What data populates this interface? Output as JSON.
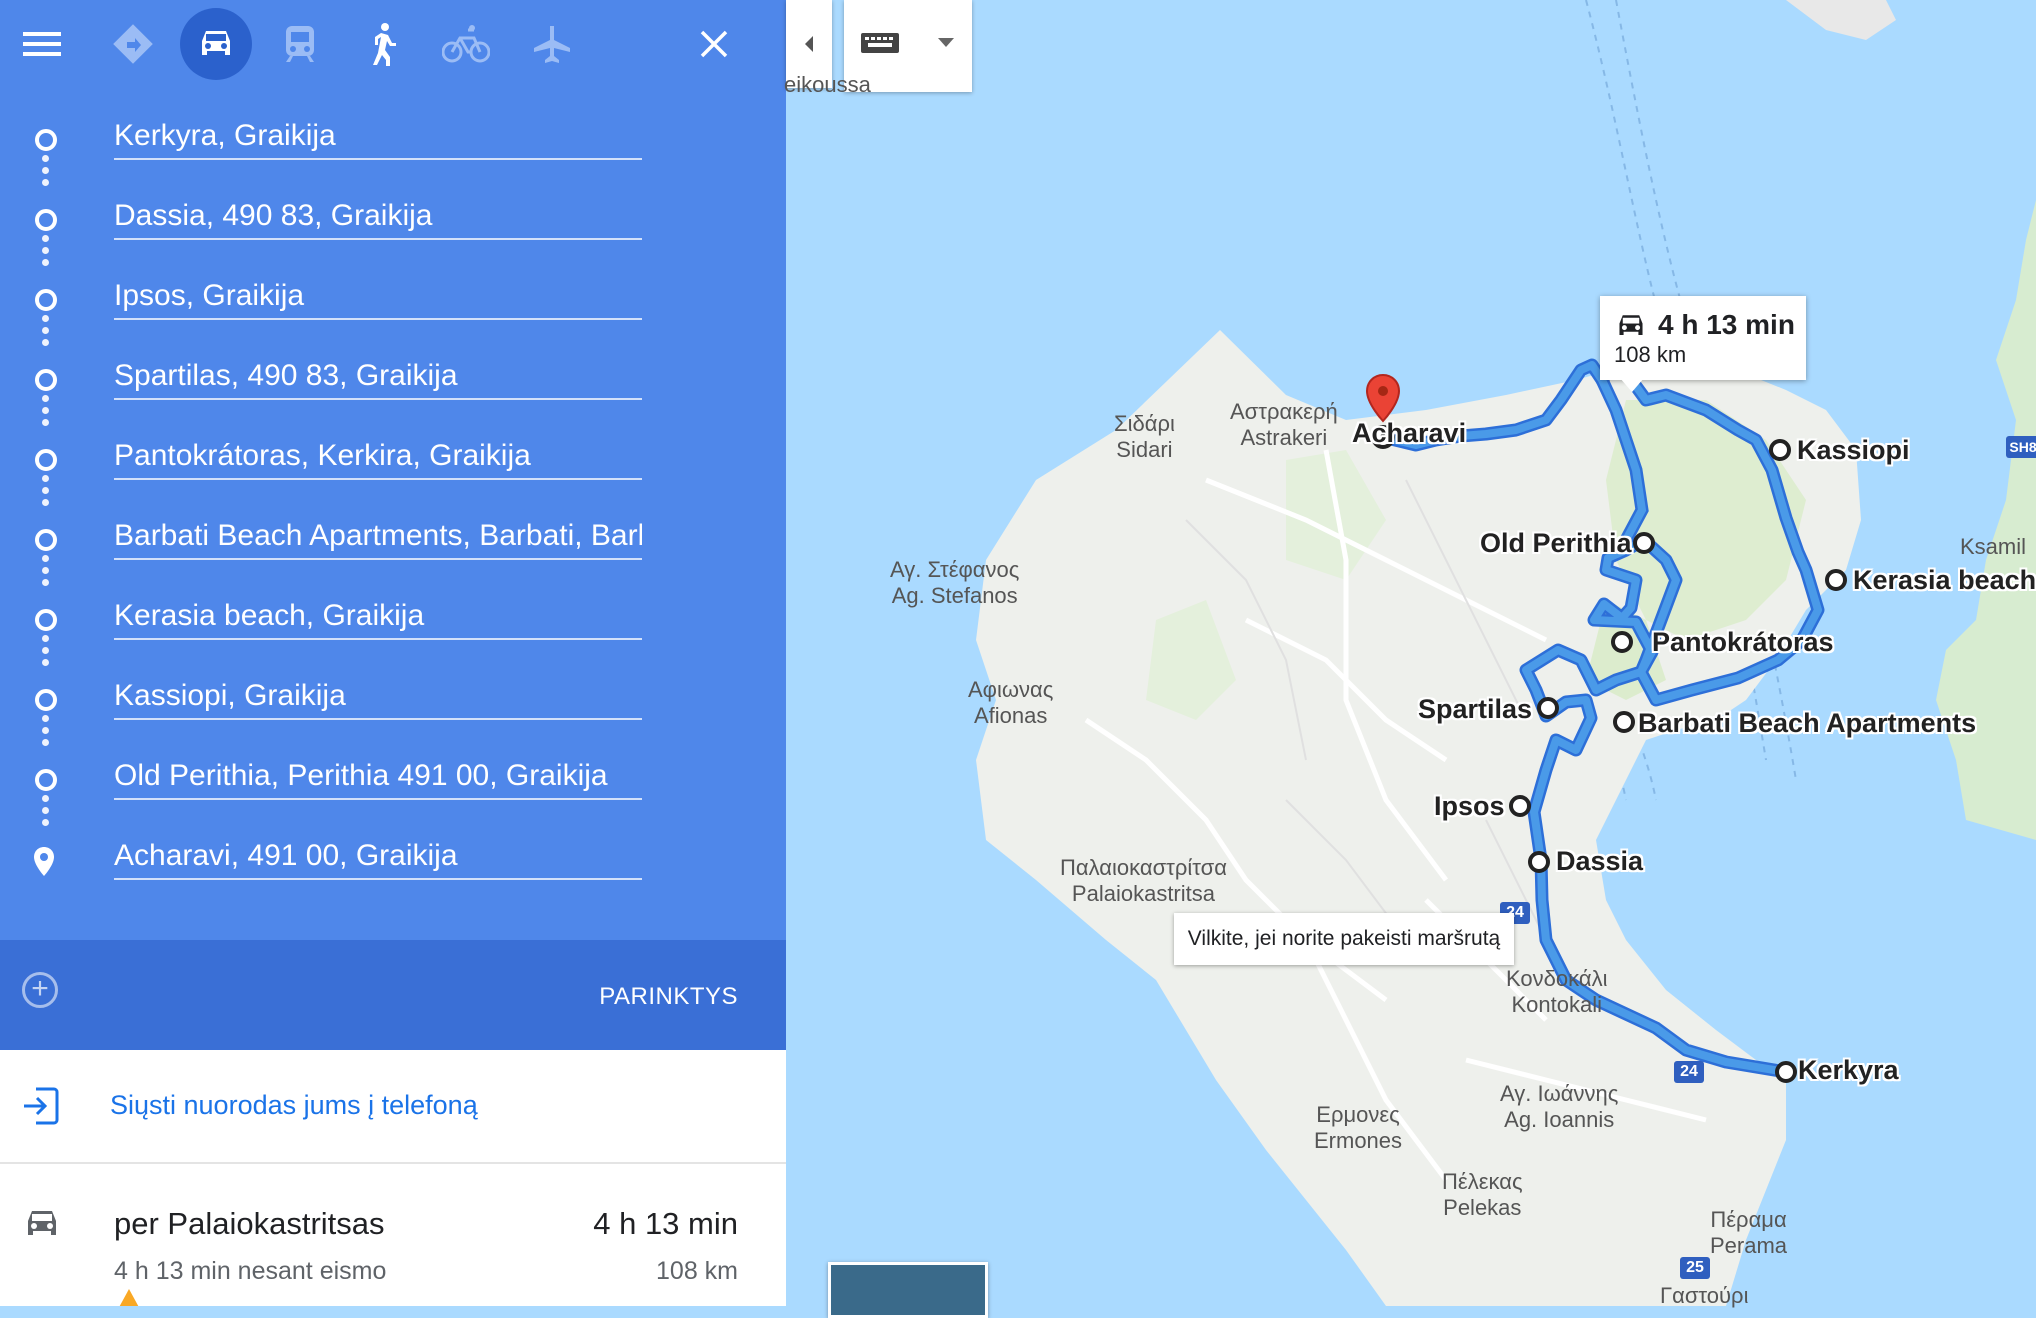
{
  "travel_modes": [
    {
      "name": "best-route",
      "active": false
    },
    {
      "name": "driving",
      "active": true
    },
    {
      "name": "transit",
      "active": false
    },
    {
      "name": "walking",
      "active": false
    },
    {
      "name": "cycling",
      "active": false
    },
    {
      "name": "flights",
      "active": false
    }
  ],
  "waypoints": [
    "Kerkyra, Graikija",
    "Dassia, 490 83, Graikija",
    "Ipsos, Graikija",
    "Spartilas, 490 83, Graikija",
    "Pantokrátoras, Kerkira, Graikija",
    "Barbati Beach Apartments, Barbati, Barbati, Graikija",
    "Kerasia beach, Graikija",
    "Kassiopi, Graikija",
    "Old Perithia, Perithia 491 00, Graikija",
    "Acharavi, 491 00, Graikija"
  ],
  "options_label": "PARINKTYS",
  "send_to_phone": "Siųsti nuorodas jums į telefoną",
  "route": {
    "via": "per Palaiokastritsas",
    "duration": "4 h 13 min",
    "traffic_note": "4 h 13 min nesant eismo",
    "distance": "108 km"
  },
  "map": {
    "route_color": "#4a9ae8",
    "info_box": {
      "duration": "4 h 13 min",
      "distance": "108 km"
    },
    "tooltip": "Vilkite, jei norite pakeisti maršrutą",
    "waypoint_labels": [
      "Acharavi",
      "Kassiopi",
      "Old Perithia",
      "Kerasia beach",
      "Pantokrátoras",
      "Spartilas",
      "Barbati Beach Apartments",
      "Ipsos",
      "Dassia",
      "Kerkyra"
    ],
    "place_labels": [
      {
        "id": "sidari",
        "greek": "Σιδάρι",
        "latin": "Sidari"
      },
      {
        "id": "astrakeri",
        "greek": "Αστρακερή",
        "latin": "Astrakeri"
      },
      {
        "id": "agstefanos",
        "greek": "Αγ. Στέφανος",
        "latin": "Ag. Stefanos"
      },
      {
        "id": "afionas",
        "greek": "Αφιωνας",
        "latin": "Afionas"
      },
      {
        "id": "palaiokastritsa",
        "greek": "Παλαιοκαστρίτσα",
        "latin": "Palaiokastritsa"
      },
      {
        "id": "kontokali",
        "greek": "Κονδοκάλι",
        "latin": "Kontokali"
      },
      {
        "id": "agioannis",
        "greek": "Αγ. Ιωάννης",
        "latin": "Ag. Ioannis"
      },
      {
        "id": "ermones",
        "greek": "Ερμονες",
        "latin": "Ermones"
      },
      {
        "id": "pelekas",
        "greek": "Πέλεκας",
        "latin": "Pelekas"
      },
      {
        "id": "perama",
        "greek": "Πέραμα",
        "latin": "Perama"
      },
      {
        "id": "gastouri",
        "greek": "Γαστούρι",
        "latin": ""
      },
      {
        "id": "ksamil",
        "greek": "",
        "latin": "Ksamil"
      },
      {
        "id": "peroulades",
        "greek": "",
        "latin": "eikoussa"
      }
    ],
    "road_shields": [
      "24",
      "24",
      "25"
    ],
    "edge_badges": [
      "SH8"
    ]
  }
}
